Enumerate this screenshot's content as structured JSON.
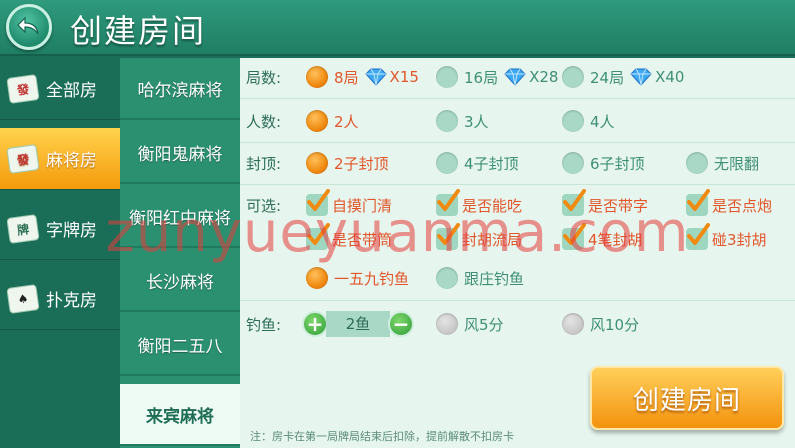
{
  "header": {
    "title": "创建房间"
  },
  "categories": [
    {
      "label": "全部房",
      "icon": "mahjong-tile-icon",
      "active": false
    },
    {
      "label": "麻将房",
      "icon": "mahjong-tile-icon",
      "active": true
    },
    {
      "label": "字牌房",
      "icon": "card-fan-icon",
      "active": false
    },
    {
      "label": "扑克房",
      "icon": "poker-card-icon",
      "active": false
    }
  ],
  "games": [
    {
      "label": "哈尔滨麻将",
      "active": false
    },
    {
      "label": "衡阳鬼麻将",
      "active": false
    },
    {
      "label": "衡阳红中麻将",
      "active": false
    },
    {
      "label": "长沙麻将",
      "active": false
    },
    {
      "label": "衡阳二五八",
      "active": false
    },
    {
      "label": "来宾麻将",
      "active": true
    }
  ],
  "options": {
    "rounds": {
      "label": "局数:",
      "items": [
        {
          "text": "8局",
          "cost": "X15",
          "selected": true
        },
        {
          "text": "16局",
          "cost": "X28",
          "selected": false
        },
        {
          "text": "24局",
          "cost": "X40",
          "selected": false
        }
      ]
    },
    "players": {
      "label": "人数:",
      "items": [
        {
          "text": "2人",
          "selected": true
        },
        {
          "text": "3人",
          "selected": false
        },
        {
          "text": "4人",
          "selected": false
        }
      ]
    },
    "cap": {
      "label": "封顶:",
      "items": [
        {
          "text": "2子封顶",
          "selected": true
        },
        {
          "text": "4子封顶",
          "selected": false
        },
        {
          "text": "6子封顶",
          "selected": false
        },
        {
          "text": "无限翻",
          "selected": false
        }
      ]
    },
    "optional": {
      "label": "可选:",
      "items": [
        {
          "text": "自摸门清",
          "checked": true
        },
        {
          "text": "是否能吃",
          "checked": true
        },
        {
          "text": "是否带字",
          "checked": true
        },
        {
          "text": "是否点炮",
          "checked": true
        },
        {
          "text": "是否带筒",
          "checked": true
        },
        {
          "text": "封胡流局",
          "checked": true
        },
        {
          "text": "4笔封胡",
          "checked": true
        },
        {
          "text": "碰3封胡",
          "checked": true
        }
      ],
      "fishing_modes": [
        {
          "text": "一五九钓鱼",
          "selected": true
        },
        {
          "text": "跟庄钓鱼",
          "selected": false
        }
      ]
    },
    "fish": {
      "label": "钓鱼:",
      "stepper_value": "2鱼",
      "items": [
        {
          "text": "风5分",
          "selected": false
        },
        {
          "text": "风10分",
          "selected": false
        }
      ]
    }
  },
  "create_button": "创建房间",
  "note": "注：房卡在第一局牌局结束后扣除，提前解散不扣房卡",
  "watermark": "zunyueyuanma.com",
  "colors": {
    "accent": "#f4930e",
    "header": "#2f9a7d",
    "panel": "#e6f6ee",
    "selected_text": "#e2562a"
  }
}
